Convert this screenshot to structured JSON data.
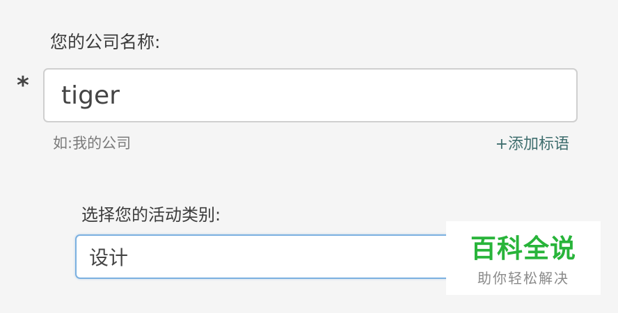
{
  "company": {
    "label": "您的公司名称:",
    "required_marker": "*",
    "value": "tiger",
    "hint": "如:我的公司",
    "add_slogan_label": "+添加标语"
  },
  "category": {
    "label": "选择您的活动类别:",
    "selected": "设计"
  },
  "watermark": {
    "brand": "百科全说",
    "tagline": "助你轻松解决"
  },
  "colors": {
    "background": "#f5f5f5",
    "link": "#3f6e6e",
    "focus_border": "#7bb0e0",
    "brand_green": "#28b43a"
  }
}
